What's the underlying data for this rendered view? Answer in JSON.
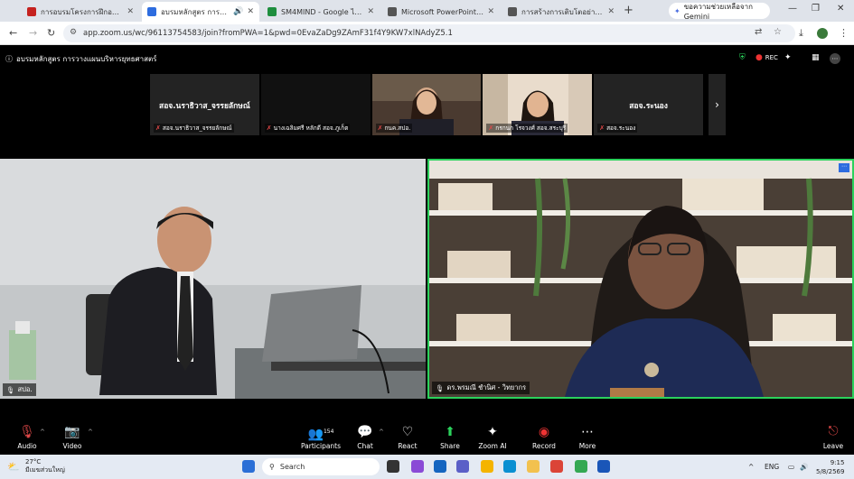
{
  "browser": {
    "tabs": [
      {
        "title": "การอบรมโครงการฝึกอบรมหลักสูตร",
        "fav": "#c5221f",
        "active": false
      },
      {
        "title": "อบรมหลักสูตร การวางแผนบริหาร",
        "fav": "#2d6cdf",
        "active": true
      },
      {
        "title": "SM4MIND - Google ไดรฟ์",
        "fav": "#1e8e3e",
        "active": false
      },
      {
        "title": "Microsoft PowerPoint - SM4",
        "fav": "#555555",
        "active": false
      },
      {
        "title": "การสร้างการเติบโตอย่างยั่งยืนด้วย",
        "fav": "#555555",
        "active": false
      }
    ],
    "new_tab": "+",
    "gemini_label": "ขอความช่วยเหลือจาก Gemini",
    "url": "app.zoom.us/wc/96113754583/join?fromPWA=1&pwd=0EvaZaDg9ZAmF31f4Y9KW7xlNAdyZ5.1"
  },
  "meeting": {
    "title": "อบรมหลักสูตร การวางแผนบริหารยุทธศาสตร์",
    "rec_label": "REC"
  },
  "gallery": [
    {
      "big": "สอจ.นราธิวาส_จรรยลักษณ์",
      "label": "สอจ.นราธิวาส_จรรยลักษณ์",
      "type": "name"
    },
    {
      "big": "",
      "label": "นางเฉลิมศรี หลักดี สอจ.ภูเก็ต",
      "type": "dark"
    },
    {
      "big": "",
      "label": "กนค.สปอ.",
      "type": "video1"
    },
    {
      "big": "",
      "label": "กรกนก โรจวงศ์ สอจ.สระบุรี",
      "type": "video2"
    },
    {
      "big": "สอจ.ระนอง",
      "label": "สอจ.ระนอง",
      "type": "name"
    }
  ],
  "main_videos": {
    "left_label": "สปอ.",
    "right_label": "ดร.พรมณี ชำนิศ - วิทยากร"
  },
  "toolbar": {
    "audio": "Audio",
    "video": "Video",
    "participants": "Participants",
    "participants_count": "154",
    "chat": "Chat",
    "react": "React",
    "share": "Share",
    "zoom_ai": "Zoom AI",
    "record": "Record",
    "more": "More",
    "leave": "Leave"
  },
  "taskbar": {
    "temp": "27°C",
    "weather": "มีเมฆส่วนใหญ่",
    "search": "Search",
    "lang": "ENG",
    "time": "9:15",
    "date": "5/8/2569"
  }
}
